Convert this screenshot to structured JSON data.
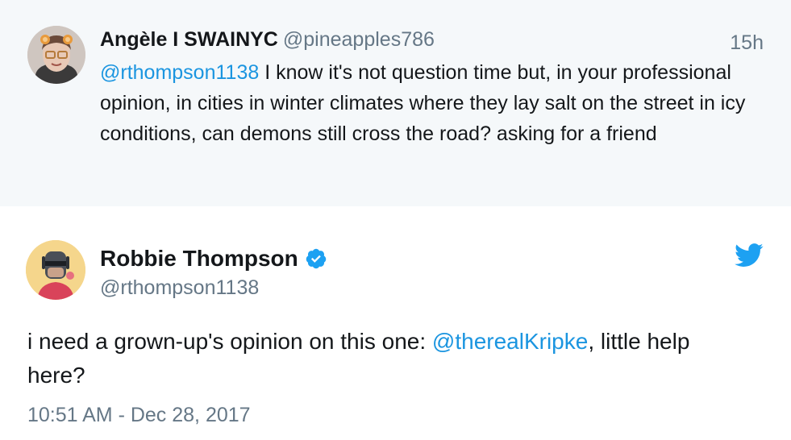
{
  "reply": {
    "author_name": "Angèle I SWAINYC",
    "author_handle": "@pineapples786",
    "time_ago": "15h",
    "mention": "@rthompson1138",
    "text": " I know it's not question time but, in your professional opinion, in cities in winter climates where they lay salt on the street in icy conditions, can demons still cross the road? asking for a friend"
  },
  "tweet": {
    "author_name": "Robbie Thompson",
    "author_handle": "@rthompson1138",
    "text_before": "i need a grown-up's opinion on this one: ",
    "mention": "@therealKripke",
    "text_after": ", little help here?",
    "timestamp": "10:51 AM - Dec 28, 2017"
  },
  "colors": {
    "link": "#1b95e0",
    "twitter_blue": "#1da1f2",
    "secondary_text": "#657786",
    "reply_background": "#f5f8fa"
  },
  "icons": {
    "verified": "verified-badge-icon",
    "brand": "twitter-bird-icon"
  }
}
